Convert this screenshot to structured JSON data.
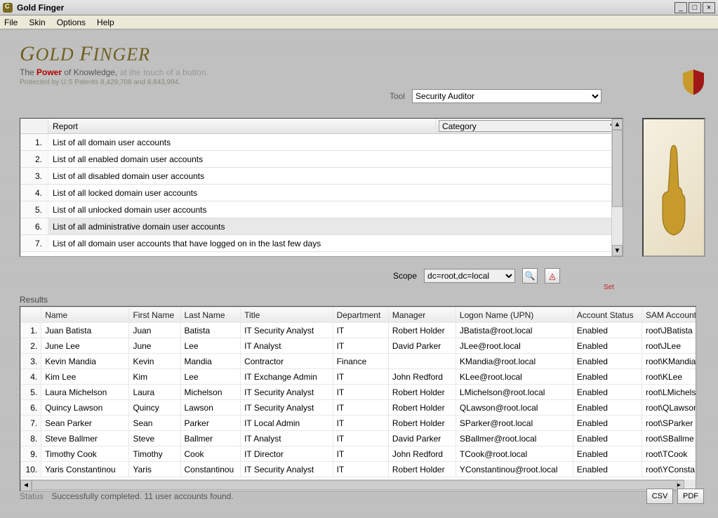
{
  "window": {
    "title": "Gold Finger"
  },
  "menu": [
    "File",
    "Skin",
    "Options",
    "Help"
  ],
  "brand": {
    "logo": "Gold Finger",
    "tagline_pre": "The ",
    "tagline_power": "Power",
    "tagline_mid": " of Knowledge, ",
    "tagline_rest": "at the touch of a button.",
    "patent": "Protected by U.S Patents 8,429,708 and 8,843,994."
  },
  "tool": {
    "label": "Tool",
    "selected": "Security Auditor"
  },
  "report": {
    "header": "Report",
    "category_label": "Category",
    "selected_index": 5,
    "items": [
      "List of all domain user accounts",
      "List of all enabled domain user accounts",
      "List of all disabled domain user accounts",
      "List of all locked domain user accounts",
      "List of all unlocked domain user accounts",
      "List of all administrative domain user accounts",
      "List of all domain user accounts that have logged on in the last few days"
    ]
  },
  "scope": {
    "label": "Scope",
    "value": "dc=root,dc=local",
    "set_label": "Set"
  },
  "results": {
    "label": "Results",
    "columns": [
      "Name",
      "First Name",
      "Last Name",
      "Title",
      "Department",
      "Manager",
      "Logon Name (UPN)",
      "Account Status",
      "SAM Account"
    ],
    "rows": [
      {
        "n": "1.",
        "name": "Juan Batista",
        "fn": "Juan",
        "ln": "Batista",
        "title": "IT Security Analyst",
        "dept": "IT",
        "mgr": "Robert Holder",
        "upn": "JBatista@root.local",
        "stat": "Enabled",
        "sam": "root\\JBatista"
      },
      {
        "n": "2.",
        "name": "June Lee",
        "fn": "June",
        "ln": "Lee",
        "title": "IT Analyst",
        "dept": "IT",
        "mgr": "David Parker",
        "upn": "JLee@root.local",
        "stat": "Enabled",
        "sam": "root\\JLee"
      },
      {
        "n": "3.",
        "name": "Kevin Mandia",
        "fn": "Kevin",
        "ln": "Mandia",
        "title": "Contractor",
        "dept": "Finance",
        "mgr": "",
        "upn": "KMandia@root.local",
        "stat": "Enabled",
        "sam": "root\\KMandia"
      },
      {
        "n": "4.",
        "name": "Kim Lee",
        "fn": "Kim",
        "ln": "Lee",
        "title": "IT Exchange Admin",
        "dept": "IT",
        "mgr": "John Redford",
        "upn": "KLee@root.local",
        "stat": "Enabled",
        "sam": "root\\KLee"
      },
      {
        "n": "5.",
        "name": "Laura Michelson",
        "fn": "Laura",
        "ln": "Michelson",
        "title": "IT Security Analyst",
        "dept": "IT",
        "mgr": "Robert Holder",
        "upn": "LMichelson@root.local",
        "stat": "Enabled",
        "sam": "root\\LMichels"
      },
      {
        "n": "6.",
        "name": "Quincy Lawson",
        "fn": "Quincy",
        "ln": "Lawson",
        "title": "IT Security Analyst",
        "dept": "IT",
        "mgr": "Robert Holder",
        "upn": "QLawson@root.local",
        "stat": "Enabled",
        "sam": "root\\QLawson"
      },
      {
        "n": "7.",
        "name": "Sean Parker",
        "fn": "Sean",
        "ln": "Parker",
        "title": "IT Local Admin",
        "dept": "IT",
        "mgr": "Robert Holder",
        "upn": "SParker@root.local",
        "stat": "Enabled",
        "sam": "root\\SParker"
      },
      {
        "n": "8.",
        "name": "Steve Ballmer",
        "fn": "Steve",
        "ln": "Ballmer",
        "title": "IT Analyst",
        "dept": "IT",
        "mgr": "David Parker",
        "upn": "SBallmer@root.local",
        "stat": "Enabled",
        "sam": "root\\SBallme"
      },
      {
        "n": "9.",
        "name": "Timothy Cook",
        "fn": "Timothy",
        "ln": "Cook",
        "title": "IT Director",
        "dept": "IT",
        "mgr": "John Redford",
        "upn": "TCook@root.local",
        "stat": "Enabled",
        "sam": "root\\TCook"
      },
      {
        "n": "10.",
        "name": "Yaris Constantinou",
        "fn": "Yaris",
        "ln": "Constantinou",
        "title": "IT Security Analyst",
        "dept": "IT",
        "mgr": "Robert Holder",
        "upn": "YConstantinou@root.local",
        "stat": "Enabled",
        "sam": "root\\YConsta"
      }
    ]
  },
  "status": {
    "label": "Status",
    "text": "Successfully completed. 11 user accounts found."
  },
  "export": {
    "csv": "CSV",
    "pdf": "PDF"
  }
}
